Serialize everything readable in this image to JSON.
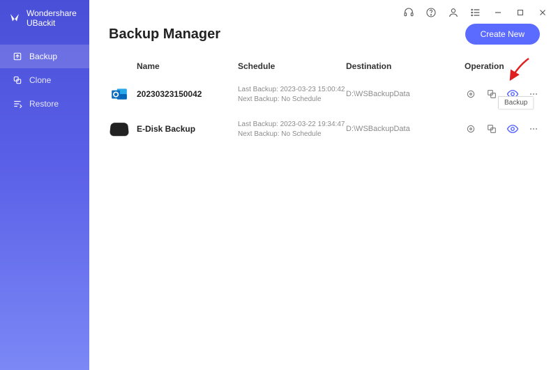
{
  "app": {
    "title": "Wondershare UBackit"
  },
  "sidebar": {
    "items": [
      {
        "label": "Backup"
      },
      {
        "label": "Clone"
      },
      {
        "label": "Restore"
      }
    ]
  },
  "header": {
    "pageTitle": "Backup Manager",
    "createButton": "Create New"
  },
  "columns": {
    "name": "Name",
    "schedule": "Schedule",
    "destination": "Destination",
    "operation": "Operation"
  },
  "rows": [
    {
      "iconType": "outlook",
      "name": "20230323150042",
      "lastBackup": "Last Backup: 2023-03-23 15:00:42",
      "nextBackup": "Next Backup: No Schedule",
      "destination": "D:\\WSBackupData"
    },
    {
      "iconType": "disk",
      "name": "E-Disk Backup",
      "lastBackup": "Last Backup: 2023-03-22 19:34:47",
      "nextBackup": "Next Backup: No Schedule",
      "destination": "D:\\WSBackupData"
    }
  ],
  "tooltip": "Backup"
}
